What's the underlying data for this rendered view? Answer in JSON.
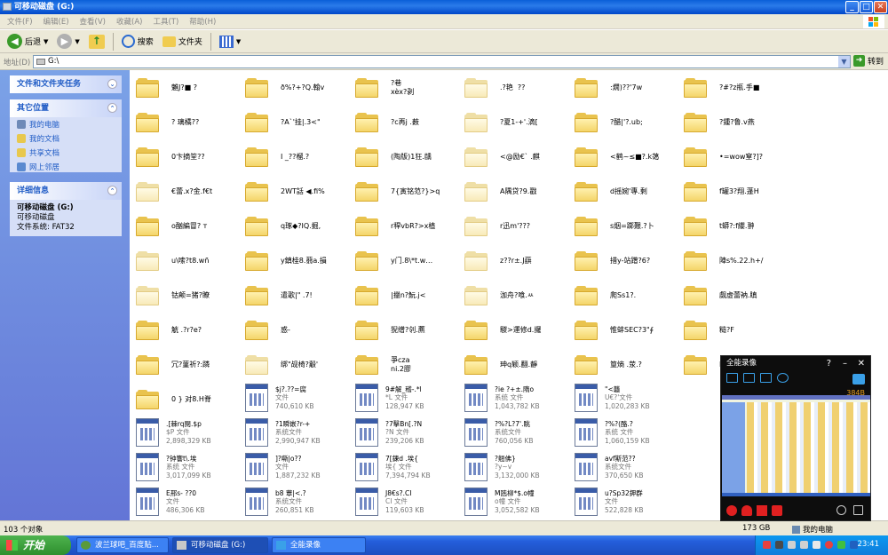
{
  "window": {
    "title": "可移动磁盘 (G:)"
  },
  "menu": [
    "文件(F)",
    "编辑(E)",
    "查看(V)",
    "收藏(A)",
    "工具(T)",
    "帮助(H)"
  ],
  "toolbar": {
    "back": "后退",
    "search": "搜索",
    "folders": "文件夹"
  },
  "address": {
    "label": "地址(D)",
    "value": "G:\\",
    "go": "转到"
  },
  "sidebar": {
    "tasks_title": "文件和文件夹任务",
    "places_title": "其它位置",
    "places": [
      "我的电脑",
      "我的文档",
      "共享文档",
      "网上邻居"
    ],
    "details_title": "详细信息",
    "details_name": "可移动磁盘 (G:)",
    "details_type": "可移动磁盘",
    "details_fs": "文件系统: FAT32"
  },
  "folders": [
    [
      "魋J?■ ?",
      "ð%?+?Q.翰v",
      "?巷\nxèx?剥",
      ".?艳  ??",
      ":燗)??'7w",
      "?#?z瓶.手■"
    ],
    [
      "? 璃橘??",
      "?A`'挂|.3<\"",
      "?c再j .薮",
      "?夏1-+'.滴[",
      "?醋|'?.ub;",
      "?鍾?鲁.v燕"
    ],
    [
      "0卞摘筌??",
      "I _??榴.?",
      "(陶版)1狂.龋",
      "<@励€` .麒",
      "<鹤~≤■?.k蔼",
      "•=wow窒?]?"
    ],
    [
      "€蕾.x?金.f€t",
      "2WT話 ◀.fi%",
      "7{寅铭范?}>q",
      "A隅贷?9.戳",
      "d摇婉'專.剩",
      "f罐3?翔.蓬H"
    ],
    [
      "o酗編冒? т",
      "q琢◆?IQ.掘,",
      "r稈vbR?>x植",
      "r迅m'???",
      "s烟=踯艱.?卜",
      "t蟒?:f纓.翀"
    ],
    [
      "u\\嗦?t8.wñ",
      "y鎮桂8.蒻a.損",
      "y门.8\\*t.w…",
      "z??r±.J蕻",
      "措y-站蹭?6?",
      "陣s%.22.h+/"
    ],
    [
      "钴颠=猪?瞭",
      "遣歌|\" .7!",
      "|擸n?魭.j<",
      "泇舟?喰.ㅆ",
      "爬Ss1?.",
      "觑虚蕾衲.瞋"
    ],
    [
      "觥 .?r?e?",
      "惑-",
      "猊缯?刢.藨",
      "騣>運修d.攞",
      "惟蚌SEC?3\"∮",
      "糙?F"
    ],
    [
      "冗?菫祈?:蹸",
      "绑\"觇椅?觳'",
      "爭cza\nni.2膠",
      "珅q颖.翻.靜",
      "篁熵 .荥.?",
      "IA"
    ],
    [
      "0 } 对8.H脊"
    ]
  ],
  "files": [
    {
      "row": 9,
      "col": 1,
      "name": "$j?.??=腐",
      "type": "文件",
      "size": "740,610 KB"
    },
    {
      "row": 9,
      "col": 2,
      "name": "9#解_稽-.*l",
      "type": "*L 文件",
      "size": "128,947 KB"
    },
    {
      "row": 9,
      "col": 3,
      "name": "?ie ?+±.隋o",
      "type": "系统 文件",
      "size": "1,043,782 KB"
    },
    {
      "row": 9,
      "col": 4,
      "name": "\"<龘",
      "type": "U€?'文件",
      "size": "1,020,283 KB"
    },
    {
      "row": 10,
      "col": 0,
      "name": ".[棘rq閱.$p",
      "type": "$P 文件",
      "size": "2,898,329 KB"
    },
    {
      "row": 10,
      "col": 1,
      "name": "?1瞬嵌?r-+",
      "type": "系统文件",
      "size": "2,990,947 KB"
    },
    {
      "row": 10,
      "col": 2,
      "name": "?7擊Bn[.?N",
      "type": "?N 文件",
      "size": "239,206 KB"
    },
    {
      "row": 10,
      "col": 3,
      "name": "?%?L?7'.眺",
      "type": "系统文件",
      "size": "760,056 KB"
    },
    {
      "row": 10,
      "col": 4,
      "name": "?%?(酪.?",
      "type": "系统 文件",
      "size": "1,060,159 KB"
    },
    {
      "row": 11,
      "col": 0,
      "name": "?钟響t\\.埃",
      "type": "系统 文件",
      "size": "3,017,099 KB"
    },
    {
      "row": 11,
      "col": 1,
      "name": "]?嘶|o??",
      "type": "文件",
      "size": "1,887,232 KB"
    },
    {
      "row": 11,
      "col": 2,
      "name": "7[鍊d .埃{",
      "type": "埃{ 文件",
      "size": "7,394,794 KB"
    },
    {
      "row": 11,
      "col": 3,
      "name": "?翹佛}",
      "type": "?y~v",
      "size": "3,132,000 KB"
    },
    {
      "row": 11,
      "col": 4,
      "name": "avf斯范??",
      "type": "系统文件",
      "size": "370,650 KB"
    },
    {
      "row": 12,
      "col": 0,
      "name": "E邢s- ??0",
      "type": "文件",
      "size": "486,306 KB"
    },
    {
      "row": 12,
      "col": 1,
      "name": "b8 蕈|<.?",
      "type": "系统文件",
      "size": "260,851 KB"
    },
    {
      "row": 12,
      "col": 2,
      "name": "J8€s?.CI",
      "type": "CI 文件",
      "size": "119,603 KB"
    },
    {
      "row": 12,
      "col": 3,
      "name": "M瓲柳*$.o幢",
      "type": "o幢 文件",
      "size": "3,052,582 KB"
    },
    {
      "row": 12,
      "col": 4,
      "name": "u?Sp32鉀群",
      "type": "文件",
      "size": "522,828 KB"
    }
  ],
  "status": {
    "count": "103 个对象",
    "size": "173 GB",
    "location": "我的电脑"
  },
  "taskbar": {
    "start": "开始",
    "tasks": [
      "波兰球吧_百度贴...",
      "可移动磁盘 (G:)",
      "全能录像"
    ],
    "clock": "23:41"
  },
  "recorder": {
    "title": "全能录像",
    "time": "384B"
  },
  "colors": {
    "xp_blue": "#0a5fd8",
    "sidebar_blue": "#7ba2e7",
    "folder_yellow": "#e9c34e",
    "start_green": "#3a9a2a"
  }
}
